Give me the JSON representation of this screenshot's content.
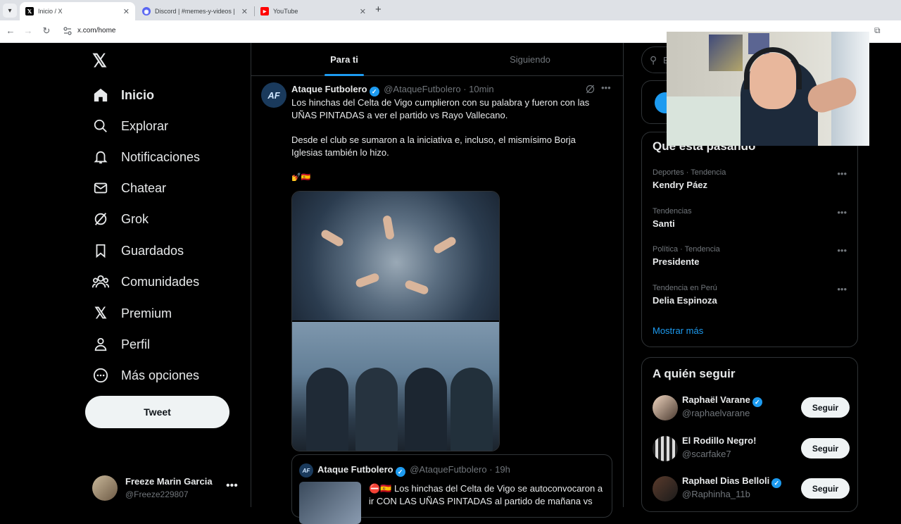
{
  "browser": {
    "tabs": [
      {
        "title": "Inicio / X",
        "favicon": "x-logo",
        "active": true
      },
      {
        "title": "Discord | #memes-y-videos | El",
        "favicon": "discord-logo",
        "active": false
      },
      {
        "title": "YouTube",
        "favicon": "youtube-logo",
        "active": false
      }
    ],
    "url": "x.com/home",
    "colors": {
      "tabbar": "#dee1e6",
      "toolbar": "#ffffff"
    }
  },
  "nav": {
    "items": [
      {
        "label": "Inicio",
        "icon": "home-icon",
        "active": true
      },
      {
        "label": "Explorar",
        "icon": "search-icon"
      },
      {
        "label": "Notificaciones",
        "icon": "bell-icon"
      },
      {
        "label": "Chatear",
        "icon": "mail-icon"
      },
      {
        "label": "Grok",
        "icon": "grok-icon"
      },
      {
        "label": "Guardados",
        "icon": "bookmark-icon"
      },
      {
        "label": "Comunidades",
        "icon": "communities-icon"
      },
      {
        "label": "Premium",
        "icon": "x-icon"
      },
      {
        "label": "Perfil",
        "icon": "person-icon"
      },
      {
        "label": "Más opciones",
        "icon": "more-circle-icon"
      }
    ],
    "tweet_button": "Tweet",
    "account": {
      "name": "Freeze Marin Garcia",
      "handle": "@Freeze229807"
    }
  },
  "feed": {
    "tabs": [
      {
        "label": "Para ti",
        "active": true
      },
      {
        "label": "Siguiendo",
        "active": false
      }
    ],
    "post": {
      "author": "Ataque Futbolero",
      "handle": "@AtaqueFutbolero",
      "time": "10min",
      "paragraphs": [
        "Los hinchas del Celta de Vigo cumplieron con su palabra y fueron con las UÑAS PINTADAS a ver el partido vs Rayo Vallecano.",
        "Desde el club se sumaron a la iniciativa e, incluso, el mismísimo Borja Iglesias también lo hizo."
      ],
      "emojis": "💅🇪🇸",
      "quote": {
        "author": "Ataque Futbolero",
        "handle": "@AtaqueFutbolero",
        "time": "19h",
        "text": "⛔🇪🇸 Los hinchas del Celta de Vigo se autoconvocaron a ir CON LAS UÑAS PINTADAS al partido de mañana vs"
      }
    }
  },
  "sidebar": {
    "search_placeholder": "B",
    "trends_title": "Qué está pasando",
    "trends": [
      {
        "context": "Deportes · Tendencia",
        "name": "Kendry Páez"
      },
      {
        "context": "Tendencias",
        "name": "Santi"
      },
      {
        "context": "Política · Tendencia",
        "name": "Presidente"
      },
      {
        "context": "Tendencia en Perú",
        "name": "Delia Espinoza"
      }
    ],
    "show_more": "Mostrar más",
    "follow_title": "A quién seguir",
    "follow": [
      {
        "name": "Raphaël Varane",
        "handle": "@raphaelvarane",
        "verified": true,
        "button": "Seguir"
      },
      {
        "name": "El Rodillo Negro!",
        "handle": "@scarfake7",
        "verified": false,
        "button": "Seguir"
      },
      {
        "name": "Raphael Dias Belloli",
        "handle": "@Raphinha_11b",
        "verified": true,
        "button": "Seguir"
      }
    ]
  },
  "colors": {
    "accent": "#1d9bf0",
    "background": "#000000",
    "text": "#e7e9ea",
    "muted": "#71767b",
    "border": "#2f3336"
  }
}
